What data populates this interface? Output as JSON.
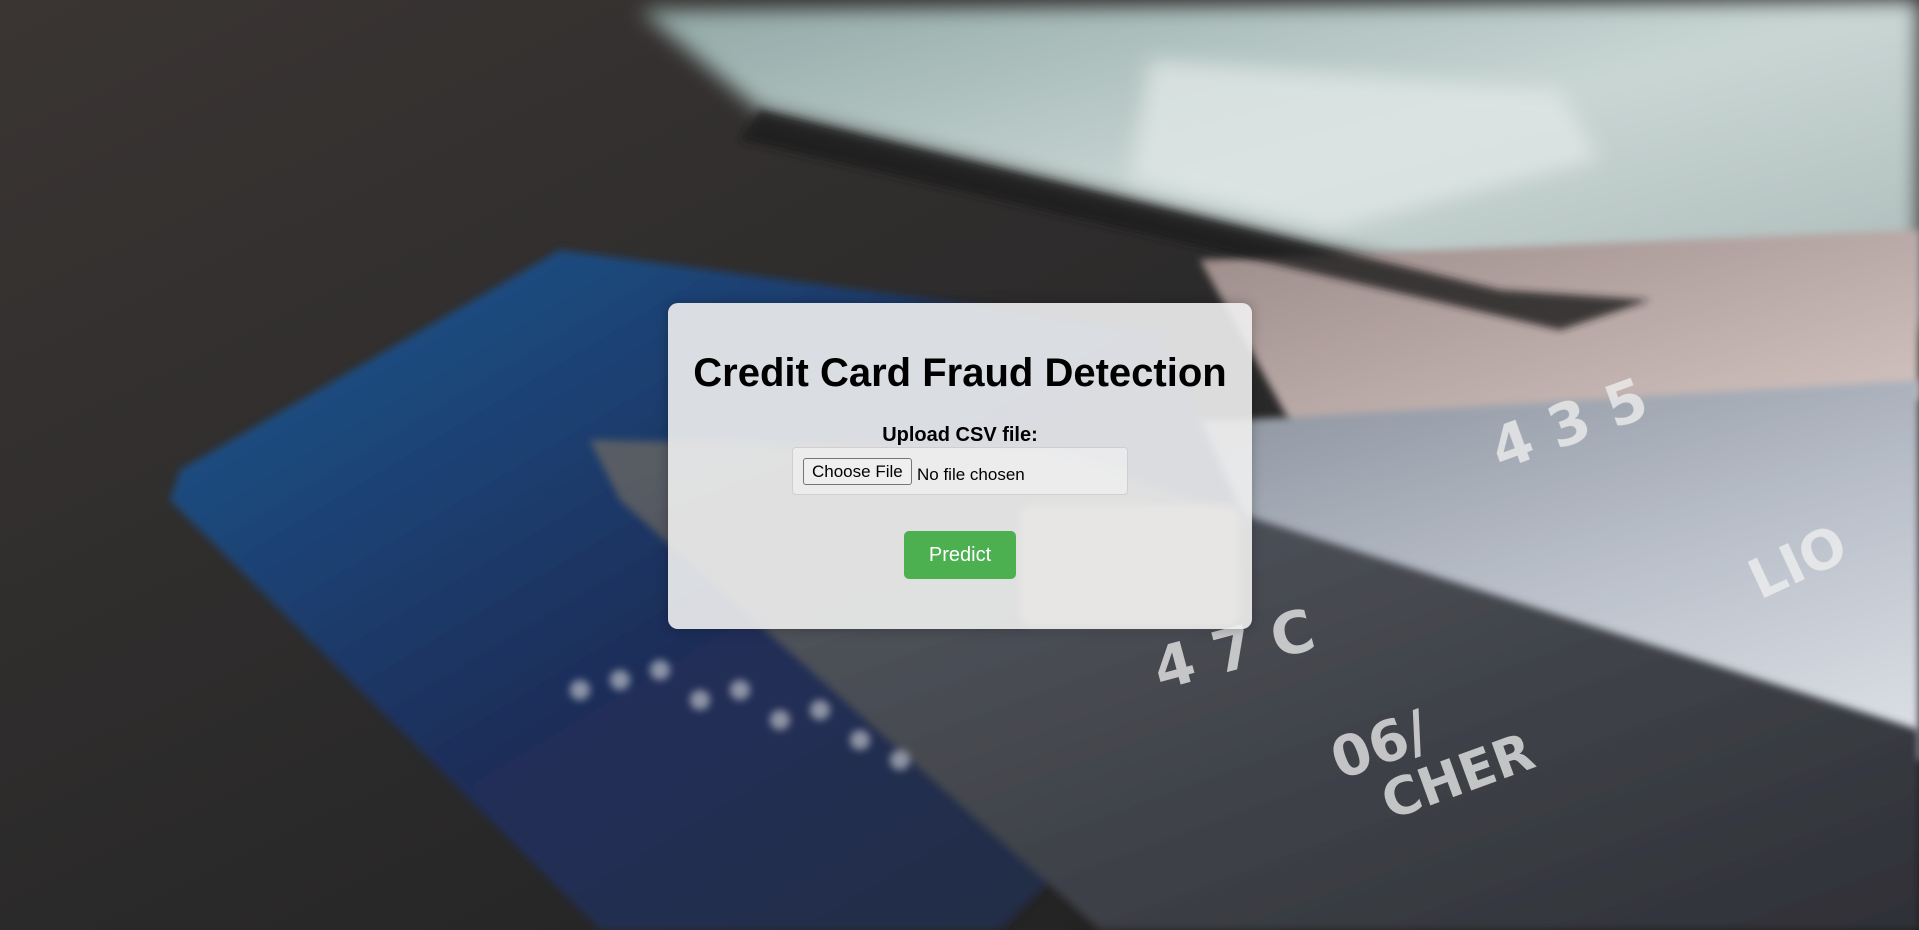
{
  "page": {
    "title": "Credit Card Fraud Detection"
  },
  "form": {
    "upload_label": "Upload CSV file:",
    "choose_file_label": "Choose File",
    "file_status": "No file chosen",
    "predict_label": "Predict"
  },
  "colors": {
    "predict_button": "#4caf50",
    "panel_background": "#f0f0f0"
  },
  "background": {
    "icon": "credit-cards-photo",
    "card_text": {
      "card_number_fragment_1": "4 3 5",
      "card_number_fragment_2": "4 7 C",
      "expiry_fragment": "06/",
      "name_fragment": "CHER",
      "partial_text": "LIO"
    }
  }
}
